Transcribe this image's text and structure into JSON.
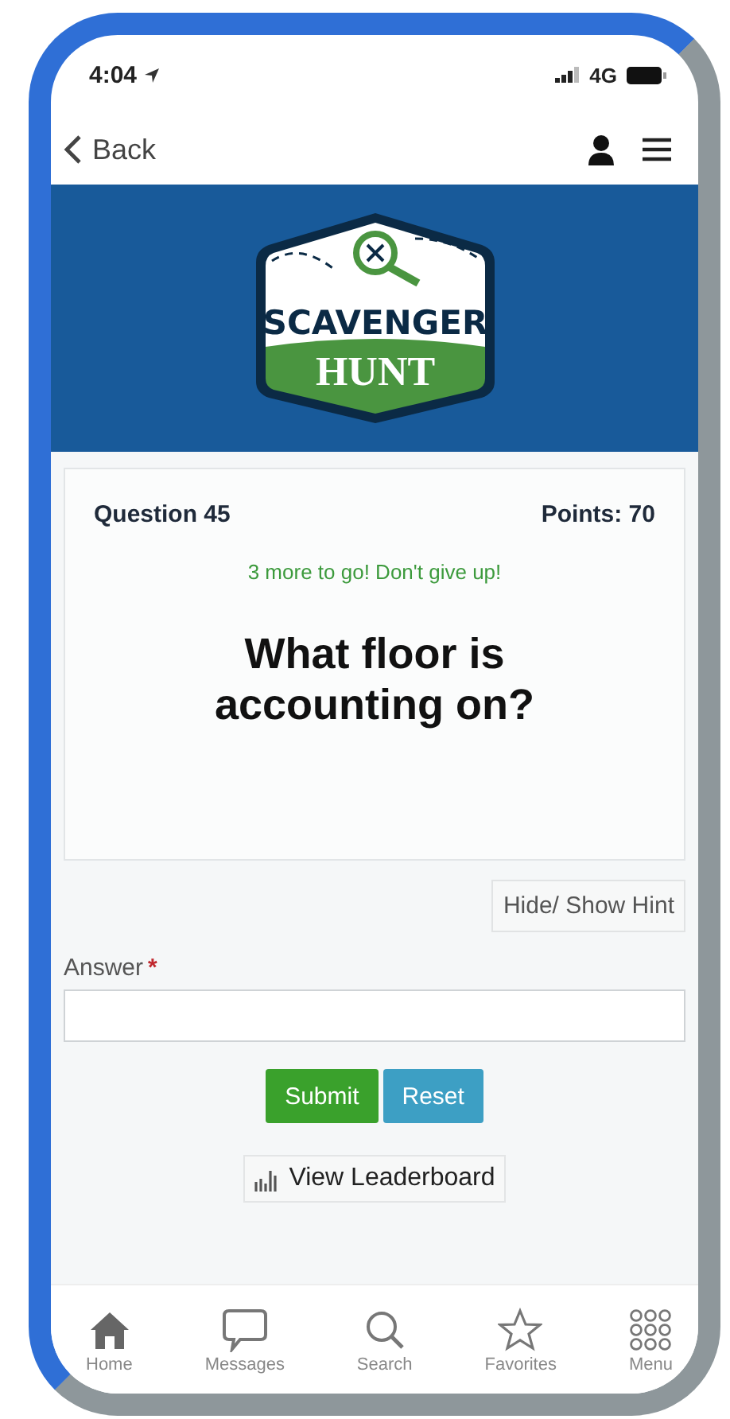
{
  "status_bar": {
    "time": "4:04",
    "network": "4G"
  },
  "nav": {
    "back": "Back"
  },
  "logo": {
    "top": "SCAVENGER",
    "bottom": "HUNT"
  },
  "question": {
    "number": "Question 45",
    "points": "Points: 70",
    "encouragement": "3 more to go! Don't give up!",
    "text": "What floor is accounting on?"
  },
  "hint_button": "Hide/ Show Hint",
  "answer": {
    "label": "Answer",
    "required_mark": "*"
  },
  "buttons": [
    {
      "label": "Submit",
      "kind": "primary"
    },
    {
      "label": "Reset",
      "kind": "secondary"
    }
  ],
  "leaderboard_button": "View Leaderboard",
  "tab_bar": [
    {
      "label": "Home",
      "kind": "home"
    },
    {
      "label": "Messages",
      "kind": "messages"
    },
    {
      "label": "Search",
      "kind": "search"
    },
    {
      "label": "Favorites",
      "kind": "favorites"
    },
    {
      "label": "Menu",
      "kind": "menu"
    }
  ]
}
